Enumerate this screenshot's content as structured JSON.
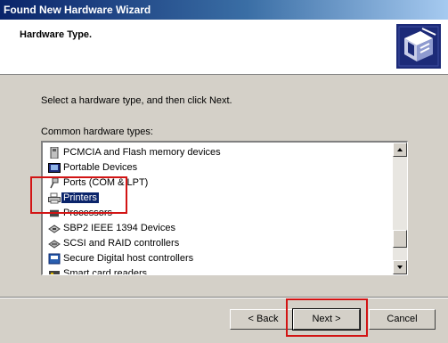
{
  "window": {
    "title": "Found New Hardware Wizard"
  },
  "header": {
    "title": "Hardware Type.",
    "icon": "hardware-wizard-icon"
  },
  "instruction": "Select a hardware type, and then click Next.",
  "list_label": "Common hardware types:",
  "hardware_types": [
    {
      "label": "PCMCIA and Flash memory devices",
      "icon": "pcmcia-icon"
    },
    {
      "label": "Portable Devices",
      "icon": "portable-device-icon"
    },
    {
      "label": "Ports (COM & LPT)",
      "icon": "port-icon"
    },
    {
      "label": "Printers",
      "icon": "printer-icon",
      "selected": true
    },
    {
      "label": "Processors",
      "icon": "processor-icon"
    },
    {
      "label": "SBP2 IEEE 1394 Devices",
      "icon": "ieee1394-icon"
    },
    {
      "label": "SCSI and RAID controllers",
      "icon": "scsi-icon"
    },
    {
      "label": "Secure Digital host controllers",
      "icon": "sd-host-icon"
    },
    {
      "label": "Smart card readers",
      "icon": "smart-card-icon"
    }
  ],
  "buttons": {
    "back": "< Back",
    "next": "Next >",
    "cancel": "Cancel"
  },
  "colors": {
    "title_bar": "#0a246a",
    "selection": "#0a246a",
    "highlight": "#d21414",
    "face": "#d4d0c8"
  }
}
